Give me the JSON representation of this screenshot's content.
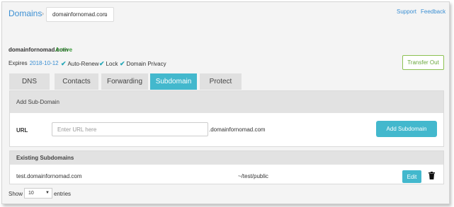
{
  "breadcrumb": {
    "root": "Domains",
    "separator": "›",
    "selected_domain": "domainfornomad.com"
  },
  "header_links": {
    "support": "Support",
    "feedback": "Feedback"
  },
  "domain": {
    "name": "domainfornomad.com",
    "status": "Active",
    "status_color": "#3c9b3c"
  },
  "info": {
    "expires_label": "Expires",
    "expires_date": "2018-10-12",
    "features": [
      "Auto-Renew",
      "Lock",
      "Domain Privacy"
    ]
  },
  "transfer_button": "Transfer Out",
  "tabs": [
    {
      "label": "DNS",
      "active": false
    },
    {
      "label": "Contacts",
      "active": false
    },
    {
      "label": "Forwarding",
      "active": false
    },
    {
      "label": "Subdomain",
      "active": true
    },
    {
      "label": "Protect",
      "active": false
    }
  ],
  "add_subdomain": {
    "title": "Add Sub-Domain",
    "url_label": "URL",
    "placeholder": "Enter URL here",
    "value": "",
    "suffix": ".domainfornomad.com",
    "button": "Add Subdomain"
  },
  "existing": {
    "title": "Existing Subdomains",
    "rows": [
      {
        "subdomain": "test.domainfornomad.com",
        "path": "~/test/public",
        "edit": "Edit"
      }
    ]
  },
  "pagination": {
    "show": "Show",
    "page_size": "10",
    "entries": "entries"
  },
  "colors": {
    "accent": "#43b8cd",
    "link": "#3b8fd3",
    "success": "#8cc152"
  },
  "icons": {
    "check": "check-icon",
    "chevron": "chevron-down-icon",
    "trash": "trash-icon"
  }
}
